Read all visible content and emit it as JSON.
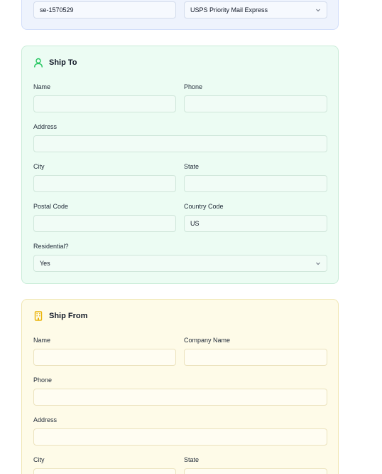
{
  "top": {
    "reference_value": "se-1570529",
    "service_value": "USPS Priority Mail Express"
  },
  "ship_to": {
    "title": "Ship To",
    "icon": "user-icon",
    "accent": "#22c55e",
    "name_label": "Name",
    "name_value": "",
    "phone_label": "Phone",
    "phone_value": "",
    "address_label": "Address",
    "address_value": "",
    "city_label": "City",
    "city_value": "",
    "state_label": "State",
    "state_value": "",
    "postal_label": "Postal Code",
    "postal_value": "",
    "country_label": "Country Code",
    "country_value": "US",
    "residential_label": "Residential?",
    "residential_value": "Yes"
  },
  "ship_from": {
    "title": "Ship From",
    "icon": "building-icon",
    "accent": "#eab308",
    "name_label": "Name",
    "name_value": "",
    "company_label": "Company Name",
    "company_value": "",
    "phone_label": "Phone",
    "phone_value": "",
    "address_label": "Address",
    "address_value": "",
    "city_label": "City",
    "city_value": "",
    "state_label": "State",
    "state_value": ""
  }
}
